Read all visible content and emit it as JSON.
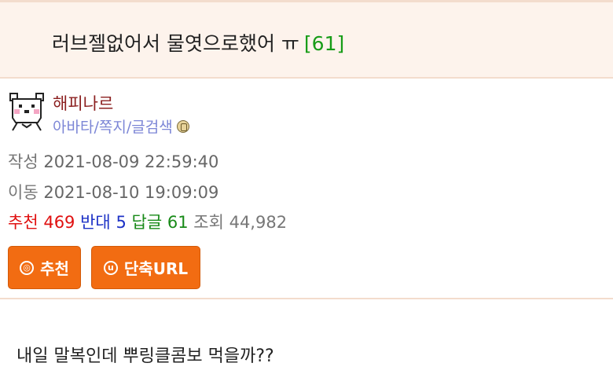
{
  "post": {
    "title": "러브젤없어서 물엿으로했어 ㅠ",
    "reply_count": "[61]"
  },
  "author": {
    "name": "해피나르",
    "link_avatar": "아바타",
    "link_message": "쪽지",
    "link_search": "글검색",
    "separator": "/",
    "avatar_icon": "bear-face-icon",
    "badge_icon": "badge-icon"
  },
  "meta": {
    "created_label": "작성",
    "created_value": "2021-08-09 22:59:40",
    "moved_label": "이동",
    "moved_value": "2021-08-10 19:09:09"
  },
  "stats": {
    "recommend_label": "추천",
    "recommend_value": "469",
    "oppose_label": "반대",
    "oppose_value": "5",
    "reply_label": "답글",
    "reply_value": "61",
    "views_label": "조회",
    "views_value": "44,982"
  },
  "buttons": {
    "recommend_icon_glyph": "◎",
    "recommend_label": "추천",
    "shorturl_icon_glyph": "u",
    "shorturl_label": "단축URL"
  },
  "content": {
    "body": "내일 말복인데 뿌링클콤보 먹을까??"
  },
  "colors": {
    "title_bg": "#fdf3ec",
    "author_name": "#8b1f1f",
    "link": "#7c86d6",
    "recommend": "#e01010",
    "oppose": "#1d32c6",
    "reply": "#188a18",
    "button_bg": "#f26c12"
  }
}
